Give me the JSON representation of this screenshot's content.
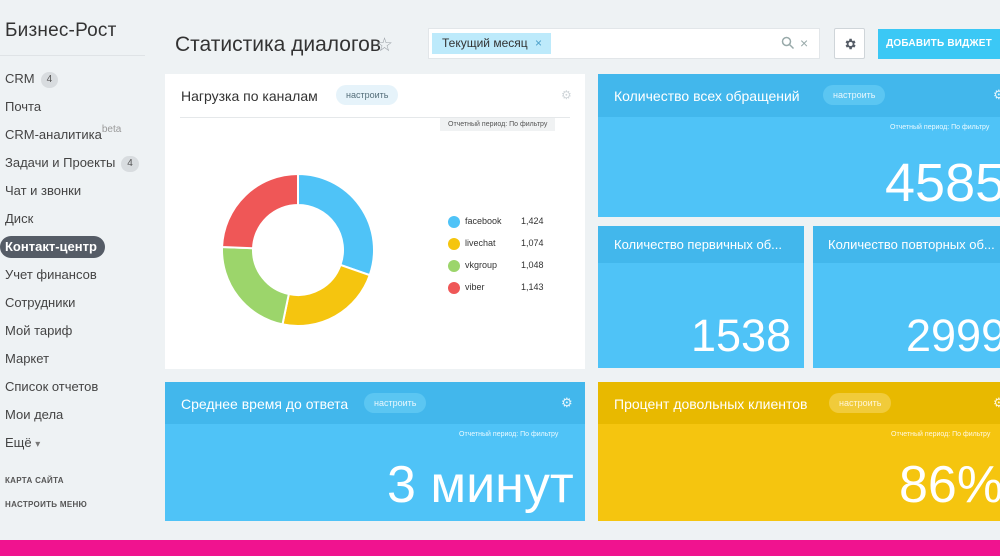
{
  "app": {
    "logo": "Бизнес-Рост"
  },
  "sidebar": {
    "items": [
      {
        "label": "CRM",
        "counter": "4"
      },
      {
        "label": "Почта"
      },
      {
        "label": "CRM-аналитика",
        "sup": "beta"
      },
      {
        "label": "Задачи и Проекты",
        "counter": "4"
      },
      {
        "label": "Чат и звонки"
      },
      {
        "label": "Диск"
      },
      {
        "label": "Контакт-центр",
        "active": true
      },
      {
        "label": "Учет финансов"
      },
      {
        "label": "Сотрудники"
      },
      {
        "label": "Мой тариф"
      },
      {
        "label": "Маркет"
      },
      {
        "label": "Список отчетов"
      },
      {
        "label": "Мои дела"
      },
      {
        "label": "Ещё",
        "more": true
      }
    ],
    "sitemap": "КАРТА САЙТА",
    "configure_menu": "НАСТРОИТЬ МЕНЮ"
  },
  "header": {
    "title": "Статистика диалогов",
    "filter_chip": "Текущий месяц",
    "chip_close": "×",
    "clear": "×",
    "add_widget": "ДОБАВИТЬ ВИДЖЕТ"
  },
  "widgets": {
    "channels": {
      "title": "Нагрузка по каналам",
      "configure": "настроить",
      "period": "Отчетный период: По фильтру",
      "chart_data": {
        "type": "pie",
        "categories": [
          "facebook",
          "livechat",
          "vkgroup",
          "viber"
        ],
        "values": [
          1424,
          1074,
          1048,
          1143
        ],
        "value_labels": [
          "1,424",
          "1,074",
          "1,048",
          "1,143"
        ],
        "colors": [
          "#4fc3f7",
          "#f5c50f",
          "#9cd56b",
          "#ef5757"
        ],
        "donut": true
      }
    },
    "total": {
      "title": "Количество всех обращений",
      "configure": "настроить",
      "period": "Отчетный период: По фильтру",
      "value": "4585"
    },
    "first": {
      "title": "Количество первичных об...",
      "value": "1538"
    },
    "repeat": {
      "title": "Количество повторных об...",
      "value": "2999"
    },
    "response": {
      "title": "Среднее время до ответа",
      "configure": "настроить",
      "period": "Отчетный период: По фильтру",
      "value": "3 минут"
    },
    "satisfied": {
      "title": "Процент довольных клиентов",
      "configure": "настроить",
      "period": "Отчетный период: По фильтру",
      "value": "86%"
    }
  },
  "colors": {
    "accent": "#3bc8f5",
    "widget_blue": "#4fc3f7",
    "widget_yellow": "#f5c50f",
    "bottom_bar": "#f0138f"
  }
}
